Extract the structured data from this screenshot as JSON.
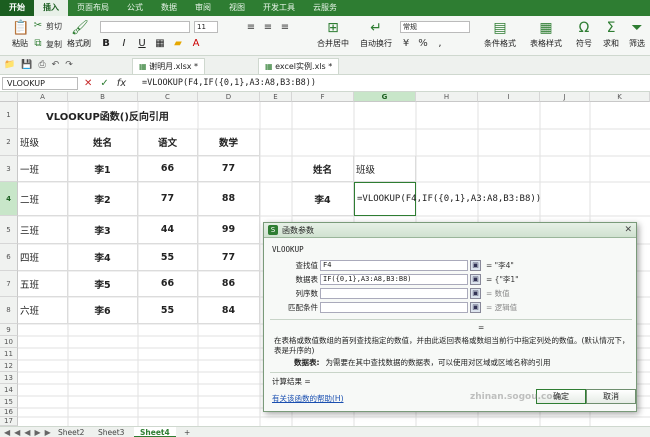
{
  "menu_tabs": [
    "开始",
    "插入",
    "页面布局",
    "公式",
    "数据",
    "审阅",
    "视图",
    "开发工具",
    "云服务"
  ],
  "ribbon": {
    "cut": "剪切",
    "paste": "粘贴",
    "copy": "复制",
    "format_painter": "格式刷",
    "merge_center": "合并居中",
    "wrap_text": "自动换行",
    "number_format": "常规",
    "conditional_format": "条件格式",
    "table_style": "表格样式",
    "symbol": "符号",
    "sum": "求和",
    "filter": "筛选",
    "font_size": "11"
  },
  "doc_tabs": [
    "谢明月.xlsx *",
    "excel实例.xls *"
  ],
  "name_box": "VLOOKUP",
  "formula": "=VLOOKUP(F4,IF({0,1},A3:A8,B3:B8))",
  "columns": [
    "A",
    "B",
    "C",
    "D",
    "E",
    "F",
    "G",
    "H",
    "I",
    "J",
    "K"
  ],
  "rows": [
    "1",
    "2",
    "3",
    "4",
    "5",
    "6",
    "7",
    "8",
    "9",
    "10",
    "11",
    "12",
    "13",
    "14",
    "15",
    "16",
    "17"
  ],
  "sheet": {
    "title": "VLOOKUP函数()反向引用",
    "headers": [
      "班级",
      "姓名",
      "语文",
      "数学"
    ],
    "records": [
      [
        "一班",
        "李1",
        "66",
        "77"
      ],
      [
        "二班",
        "李2",
        "77",
        "88"
      ],
      [
        "三班",
        "李3",
        "44",
        "99"
      ],
      [
        "四班",
        "李4",
        "55",
        "77"
      ],
      [
        "五班",
        "李5",
        "66",
        "86"
      ],
      [
        "六班",
        "李6",
        "55",
        "84"
      ]
    ],
    "lookup_name_label": "姓名",
    "lookup_class_label": "班级",
    "lookup_name_value": "李4",
    "lookup_formula": "=VLOOKUP(F4,IF({0,1},A3:A8,B3:B8))"
  },
  "sheet_tabs": [
    "Sheet2",
    "Sheet3",
    "Sheet4"
  ],
  "dialog": {
    "title": "函数参数",
    "function_name": "VLOOKUP",
    "params": [
      {
        "label": "查找值",
        "value": "F4",
        "result": "= \"李4\""
      },
      {
        "label": "数据表",
        "value": "IF({0,1},A3:A8,B3:B8)",
        "result": "= {\"李1\""
      },
      {
        "label": "列序数",
        "value": "",
        "result": "= 数值"
      },
      {
        "label": "匹配条件",
        "value": "",
        "result": "= 逻辑值"
      }
    ],
    "equals": "=",
    "description": "在表格或数值数组的首列查找指定的数值，并由此返回表格或数组当前行中指定列处的数值。(默认情况下，表是升序的)",
    "param_name": "数据表:",
    "param_desc": "为需要在其中查找数据的数据表，可以使用对区域或区域名称的引用",
    "calc_result": "计算结果 =",
    "help_link": "有关该函数的帮助(H)",
    "ok": "确定",
    "cancel": "取消"
  },
  "watermark": "zhinan.sogou.com"
}
